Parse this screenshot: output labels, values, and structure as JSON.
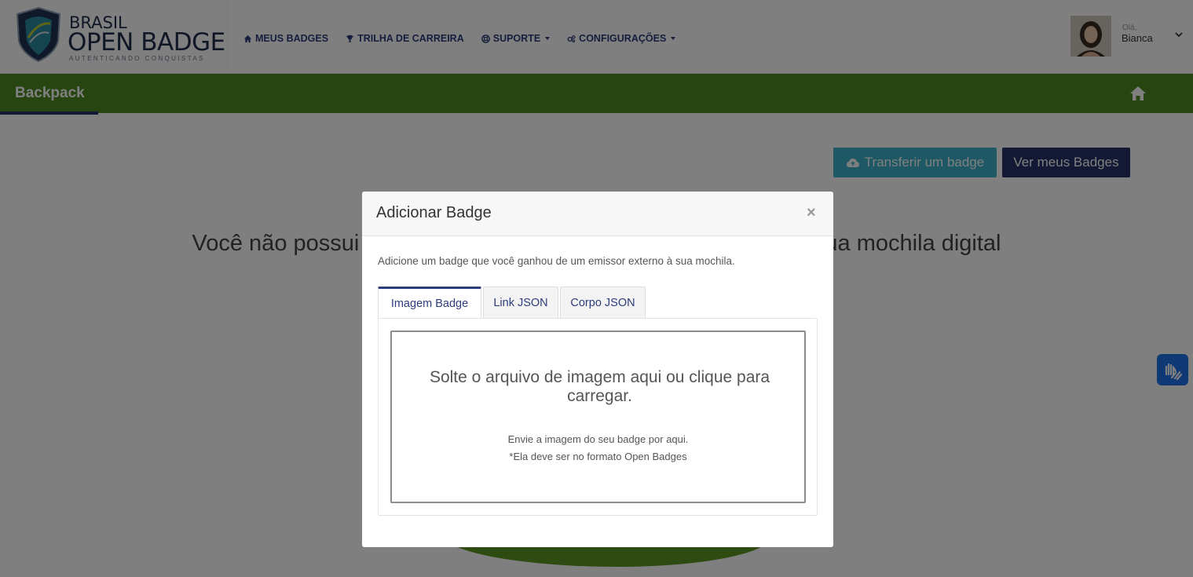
{
  "brand": {
    "line1": "BRASIL",
    "line2": "OPEN BADGE",
    "tagline": "AUTENTICANDO CONQUISTAS"
  },
  "nav": {
    "items": [
      {
        "label": "MEUS BADGES",
        "icon": "home-icon"
      },
      {
        "label": "TRILHA DE CARREIRA",
        "icon": "trophy-icon"
      },
      {
        "label": "SUPORTE",
        "icon": "lifebuoy-icon"
      },
      {
        "label": "CONFIGURAÇÕES",
        "icon": "gears-icon"
      }
    ]
  },
  "user": {
    "greeting": "Olá,",
    "name": "Bianca"
  },
  "subbar": {
    "title": "Backpack"
  },
  "actions": {
    "transfer_label": "Transferir um badge",
    "view_badges_label": "Ver meus Badges"
  },
  "empty_state": {
    "message_left": "Você não possui",
    "message_right": "ua mochila digital"
  },
  "modal": {
    "title": "Adicionar Badge",
    "close": "×",
    "description": "Adicione um badge que você ganhou de um emissor externo à sua mochila.",
    "tabs": [
      {
        "label": "Imagem Badge",
        "active": true
      },
      {
        "label": "Link JSON",
        "active": false
      },
      {
        "label": "Corpo JSON",
        "active": false
      }
    ],
    "dropzone": {
      "title": "Solte o arquivo de imagem aqui ou clique para carregar.",
      "line1": "Envie a imagem do seu badge por aqui.",
      "line2": "*Ela deve ser no formato Open Badges"
    }
  },
  "colors": {
    "navy": "#26326a",
    "green": "#4e8a22",
    "teal": "#3bb0c9",
    "vlibras_blue": "#1e73e8"
  }
}
